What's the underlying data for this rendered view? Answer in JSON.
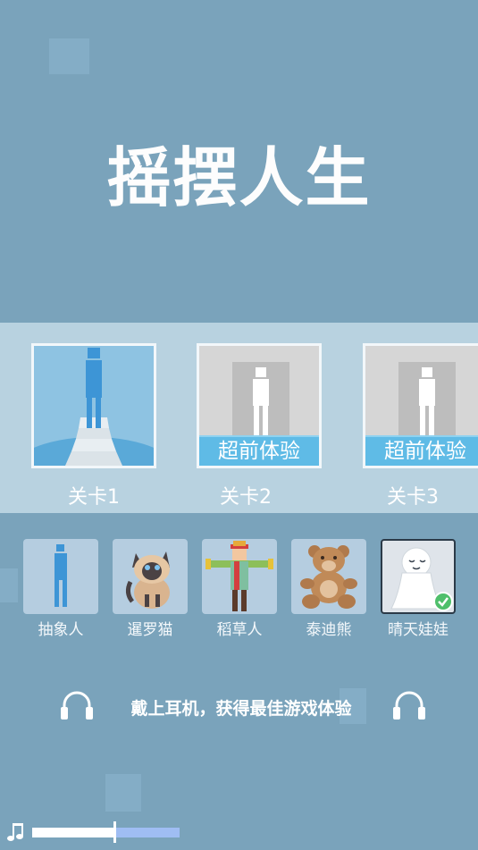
{
  "title": "摇摆人生",
  "levels": [
    {
      "label": "关卡1",
      "state": "unlocked",
      "ribbon": ""
    },
    {
      "label": "关卡2",
      "state": "locked",
      "ribbon": "超前体验"
    },
    {
      "label": "关卡3",
      "state": "locked",
      "ribbon": "超前体验"
    }
  ],
  "characters": [
    {
      "label": "抽象人",
      "icon": "abstract-man-icon",
      "selected": false
    },
    {
      "label": "暹罗猫",
      "icon": "siamese-cat-icon",
      "selected": false
    },
    {
      "label": "稻草人",
      "icon": "scarecrow-icon",
      "selected": false
    },
    {
      "label": "泰迪熊",
      "icon": "teddy-bear-icon",
      "selected": false
    },
    {
      "label": "晴天娃娃",
      "icon": "teru-teru-bozu-icon",
      "selected": true
    }
  ],
  "hint": "戴上耳机，获得最佳游戏体验",
  "volume": {
    "level": 0.56
  },
  "colors": {
    "background": "#7aa3bb",
    "band": "#b8d2e0",
    "accent": "#5fbbe6",
    "figure_blue": "#3d95d6",
    "check_green": "#4fbf6b"
  }
}
